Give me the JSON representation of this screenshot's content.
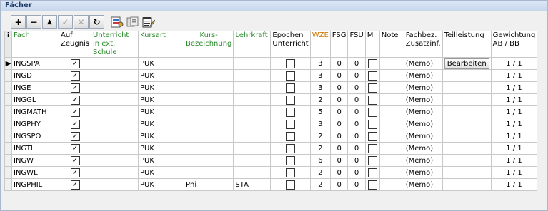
{
  "panel": {
    "title": "Fächer"
  },
  "toolbar": {
    "add": "+",
    "remove": "−",
    "up": "▲",
    "confirm": "✓",
    "cancel": "✕",
    "refresh": "↻"
  },
  "grid": {
    "indicator_header": "i",
    "row_marker": "▶",
    "columns": {
      "fach": "Fach",
      "zeugnis": "Auf Zeugnis",
      "extern": "Unterricht in ext. Schule",
      "kursart": "Kursart",
      "kursbez": "Kurs-Bezeichnung",
      "lehrkraft": "Lehrkraft",
      "epochen": "Epochen Unterricht",
      "wze": "WZE",
      "fsg": "FSG",
      "fsu": "FSU",
      "m": "M",
      "note": "Note",
      "zusatz": "Fachbez. Zusatzinf.",
      "teil": "Teilleistung",
      "gewichtung": "Gewichtung AB / BB"
    },
    "edit_button": "Bearbeiten",
    "check": "✓",
    "rows": [
      {
        "fach": "INGSPA",
        "kursart": "PUK",
        "kursbez": "",
        "lehrkraft": "",
        "wze": "3",
        "fsg": "0",
        "fsu": "0",
        "zusatz": "(Memo)",
        "gewichtung": "1 / 1"
      },
      {
        "fach": "INGD",
        "kursart": "PUK",
        "kursbez": "",
        "lehrkraft": "",
        "wze": "3",
        "fsg": "0",
        "fsu": "0",
        "zusatz": "(Memo)",
        "gewichtung": "1 / 1"
      },
      {
        "fach": "INGE",
        "kursart": "PUK",
        "kursbez": "",
        "lehrkraft": "",
        "wze": "3",
        "fsg": "0",
        "fsu": "0",
        "zusatz": "(Memo)",
        "gewichtung": "1 / 1"
      },
      {
        "fach": "INGGL",
        "kursart": "PUK",
        "kursbez": "",
        "lehrkraft": "",
        "wze": "2",
        "fsg": "0",
        "fsu": "0",
        "zusatz": "(Memo)",
        "gewichtung": "1 / 1"
      },
      {
        "fach": "INGMATH",
        "kursart": "PUK",
        "kursbez": "",
        "lehrkraft": "",
        "wze": "5",
        "fsg": "0",
        "fsu": "0",
        "zusatz": "(Memo)",
        "gewichtung": "1 / 1"
      },
      {
        "fach": "INGPHY",
        "kursart": "PUK",
        "kursbez": "",
        "lehrkraft": "",
        "wze": "3",
        "fsg": "0",
        "fsu": "0",
        "zusatz": "(Memo)",
        "gewichtung": "1 / 1"
      },
      {
        "fach": "INGSPO",
        "kursart": "PUK",
        "kursbez": "",
        "lehrkraft": "",
        "wze": "2",
        "fsg": "0",
        "fsu": "0",
        "zusatz": "(Memo)",
        "gewichtung": "1 / 1"
      },
      {
        "fach": "INGTI",
        "kursart": "PUK",
        "kursbez": "",
        "lehrkraft": "",
        "wze": "2",
        "fsg": "0",
        "fsu": "0",
        "zusatz": "(Memo)",
        "gewichtung": "1 / 1"
      },
      {
        "fach": "INGW",
        "kursart": "PUK",
        "kursbez": "",
        "lehrkraft": "",
        "wze": "6",
        "fsg": "0",
        "fsu": "0",
        "zusatz": "(Memo)",
        "gewichtung": "1 / 1"
      },
      {
        "fach": "INGWL",
        "kursart": "PUK",
        "kursbez": "",
        "lehrkraft": "",
        "wze": "2",
        "fsg": "0",
        "fsu": "0",
        "zusatz": "(Memo)",
        "gewichtung": "1 / 1"
      },
      {
        "fach": "INGPHIL",
        "kursart": "PUK",
        "kursbez": "Phi",
        "lehrkraft": "STA",
        "wze": "2",
        "fsg": "0",
        "fsu": "0",
        "zusatz": "(Memo)",
        "gewichtung": "1 / 1"
      }
    ]
  }
}
